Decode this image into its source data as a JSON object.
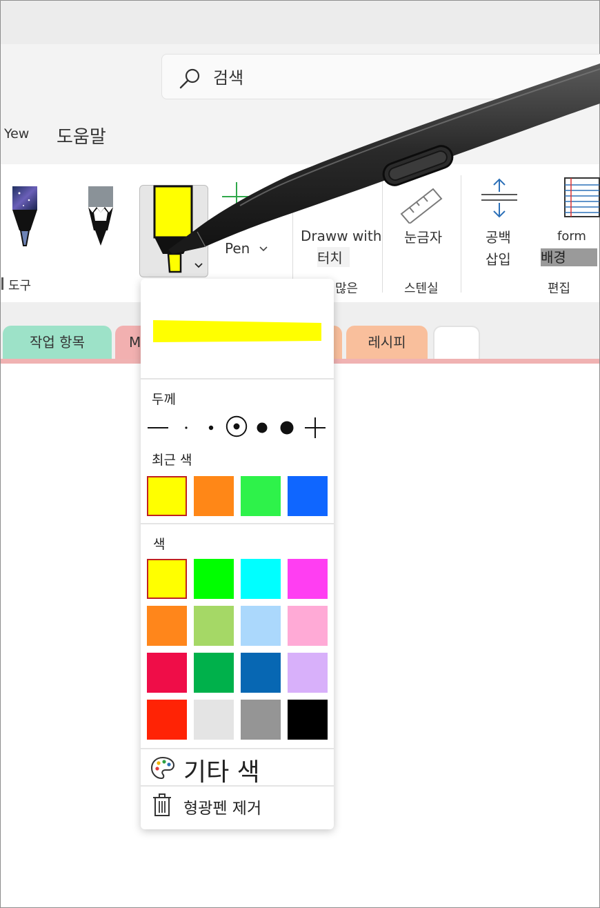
{
  "search": {
    "placeholder": "검색"
  },
  "menu": {
    "partial_item": "Yew",
    "help": "도움말"
  },
  "ribbon": {
    "group_tools_label": "도구",
    "pen_label": "Pen",
    "draw_with_touch_line1": "Draww with",
    "draw_with_touch_line2": "터치",
    "group_more_label": "많은",
    "ruler_label": "눈금자",
    "group_stencil_label": "스텐실",
    "insert_space_line1": "공백",
    "insert_space_line2": "삽입",
    "format_background_line1": "form",
    "format_background_line2": "배경",
    "group_edit_label": "편집"
  },
  "tabs": [
    {
      "label": "작업 항목",
      "color": "#9de2c8"
    },
    {
      "label": "M",
      "color": "#f2b0b0"
    },
    {
      "label": "레시피",
      "color": "#f9bf9c"
    },
    {
      "label": "",
      "color": "#ffffff"
    }
  ],
  "popup": {
    "preview_color": "#ffff00",
    "thickness_label": "두께",
    "thickness_options": [
      "thinnest",
      "very-thin",
      "thin",
      "medium",
      "thick",
      "thicker",
      "thickest"
    ],
    "thickness_selected": 3,
    "recent_label": "최근 색",
    "recent_colors": [
      "#ffff00",
      "#ff8717",
      "#2ef24a",
      "#0f66ff"
    ],
    "colors_label": "색",
    "colors": [
      "#ffff00",
      "#00ff00",
      "#00ffff",
      "#ff3ef2",
      "#ff861b",
      "#a5d866",
      "#abd8fc",
      "#ffaad6",
      "#ef0d48",
      "#00b14b",
      "#0767b3",
      "#d8b0fa",
      "#ff2305",
      "#e4e4e4",
      "#959595",
      "#000000"
    ],
    "selected_color": "#ffff00",
    "more_colors": "기타 색",
    "remove_highlighter": "형광펜 제거"
  }
}
